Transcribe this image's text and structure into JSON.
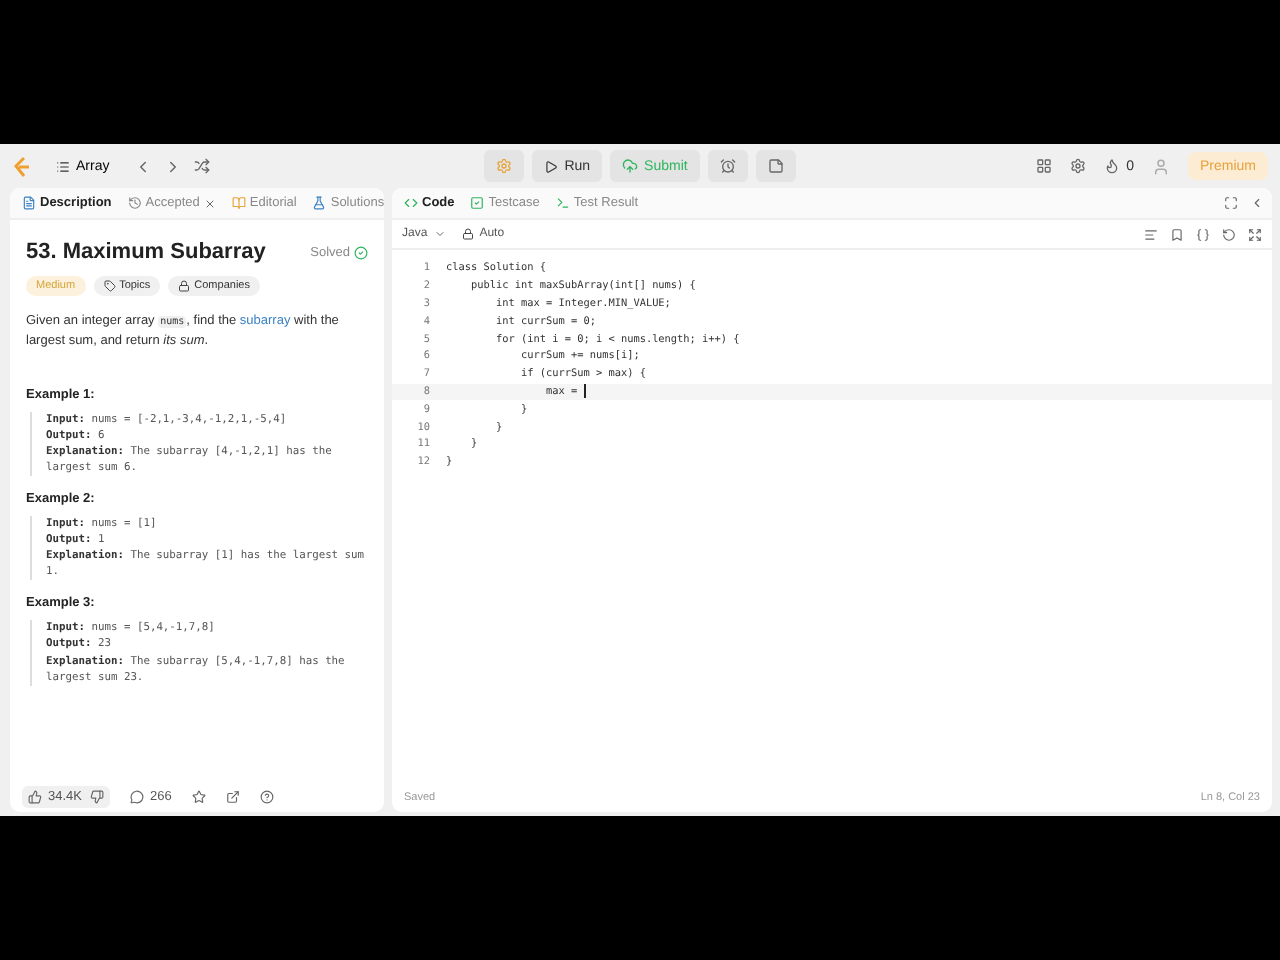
{
  "nav": {
    "problem_list": "Array",
    "run": "Run",
    "submit": "Submit",
    "streak": "0",
    "premium": "Premium"
  },
  "left_tabs": [
    {
      "label": "Description",
      "selected": true,
      "kind": "description"
    },
    {
      "label": "Accepted",
      "selected": false,
      "kind": "accepted"
    },
    {
      "label": "Editorial",
      "selected": false,
      "kind": "editorial"
    },
    {
      "label": "Solutions",
      "selected": false,
      "kind": "solutions"
    }
  ],
  "problem": {
    "title": "53. Maximum Subarray",
    "status": "Solved",
    "tags": [
      {
        "label": "Medium",
        "kind": "difficulty"
      },
      {
        "label": "Topics",
        "kind": "topics"
      },
      {
        "label": "Companies",
        "kind": "companies"
      }
    ],
    "description": [
      {
        "kind": "text",
        "text": "Given an integer array "
      },
      {
        "kind": "code",
        "text": "nums"
      },
      {
        "kind": "text",
        "text": ", find the "
      },
      {
        "kind": "link",
        "text": "subarray"
      },
      {
        "kind": "text",
        "text": " with the largest sum, and return "
      },
      {
        "kind": "italic",
        "text": "its sum"
      },
      {
        "kind": "text",
        "text": "."
      }
    ],
    "examples": [
      {
        "title": "Example 1:",
        "lines": [
          {
            "label": "Input:",
            "value": "nums = [-2,1,-3,4,-1,2,1,-5,4]"
          },
          {
            "label": "Output:",
            "value": "6"
          },
          {
            "label": "Explanation:",
            "value": "The subarray [4,-1,2,1] has the largest sum 6."
          }
        ]
      },
      {
        "title": "Example 2:",
        "lines": [
          {
            "label": "Input:",
            "value": "nums = [1]"
          },
          {
            "label": "Output:",
            "value": "1"
          },
          {
            "label": "Explanation:",
            "value": "The subarray [1] has the largest sum 1."
          }
        ]
      },
      {
        "title": "Example 3:",
        "lines": [
          {
            "label": "Input:",
            "value": "nums = [5,4,-1,7,8]"
          },
          {
            "label": "Output:",
            "value": "23"
          },
          {
            "label": "Explanation:",
            "value": "The subarray [5,4,-1,7,8] has the largest sum 23."
          }
        ]
      }
    ]
  },
  "footer": {
    "likes": "34.4K",
    "comments": "266"
  },
  "right_tabs": [
    {
      "label": "Code",
      "selected": true,
      "kind": "code"
    },
    {
      "label": "Testcase",
      "selected": false,
      "kind": "testcase"
    },
    {
      "label": "Test Result",
      "selected": false,
      "kind": "result"
    }
  ],
  "editor": {
    "language": "Java",
    "mode": "Auto",
    "lines": [
      {
        "number": "1",
        "text": "class Solution {",
        "active": false
      },
      {
        "number": "2",
        "text": "    public int maxSubArray(int[] nums) {",
        "active": false
      },
      {
        "number": "3",
        "text": "        int max = Integer.MIN_VALUE;",
        "active": false
      },
      {
        "number": "4",
        "text": "        int currSum = 0;",
        "active": false
      },
      {
        "number": "5",
        "text": "        for (int i = 0; i < nums.length; i++) {",
        "active": false
      },
      {
        "number": "6",
        "text": "            currSum += nums[i];",
        "active": false
      },
      {
        "number": "7",
        "text": "            if (currSum > max) {",
        "active": false
      },
      {
        "number": "8",
        "text": "                max = ",
        "active": true
      },
      {
        "number": "9",
        "text": "            }",
        "active": false
      },
      {
        "number": "10",
        "text": "        }",
        "active": false
      },
      {
        "number": "11",
        "text": "    }",
        "active": false
      },
      {
        "number": "12",
        "text": "}",
        "active": false
      }
    ],
    "saved": "Saved",
    "position": "Ln 8, Col 23"
  }
}
